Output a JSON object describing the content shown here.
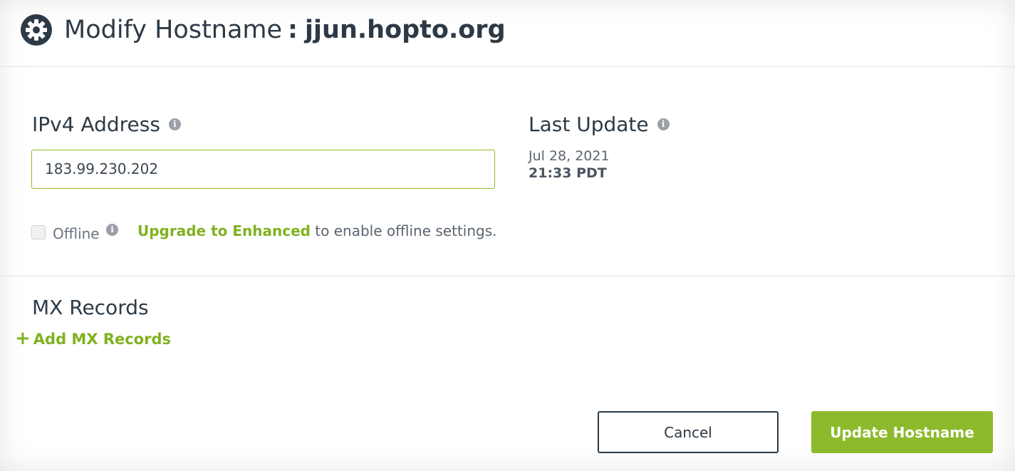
{
  "header": {
    "title_prefix": "Modify Hostname",
    "separator": ":",
    "hostname": "jjun.hopto.org",
    "icon": "gear-icon"
  },
  "ipv4": {
    "label": "IPv4 Address",
    "value": "183.99.230.202",
    "info_icon": "i"
  },
  "last_update": {
    "label": "Last Update",
    "date": "Jul 28, 2021",
    "time": "21:33 PDT",
    "info_icon": "i"
  },
  "offline": {
    "label": "Offline",
    "info_icon": "i",
    "upgrade_link": "Upgrade to Enhanced",
    "note_suffix": " to enable offline settings."
  },
  "mx": {
    "label": "MX Records",
    "add_label": "Add MX Records",
    "add_icon": "+"
  },
  "buttons": {
    "cancel": "Cancel",
    "update": "Update Hostname"
  },
  "colors": {
    "accent_green": "#8dba2c",
    "link_green": "#7fb21f",
    "text_dark": "#2d3a46"
  }
}
